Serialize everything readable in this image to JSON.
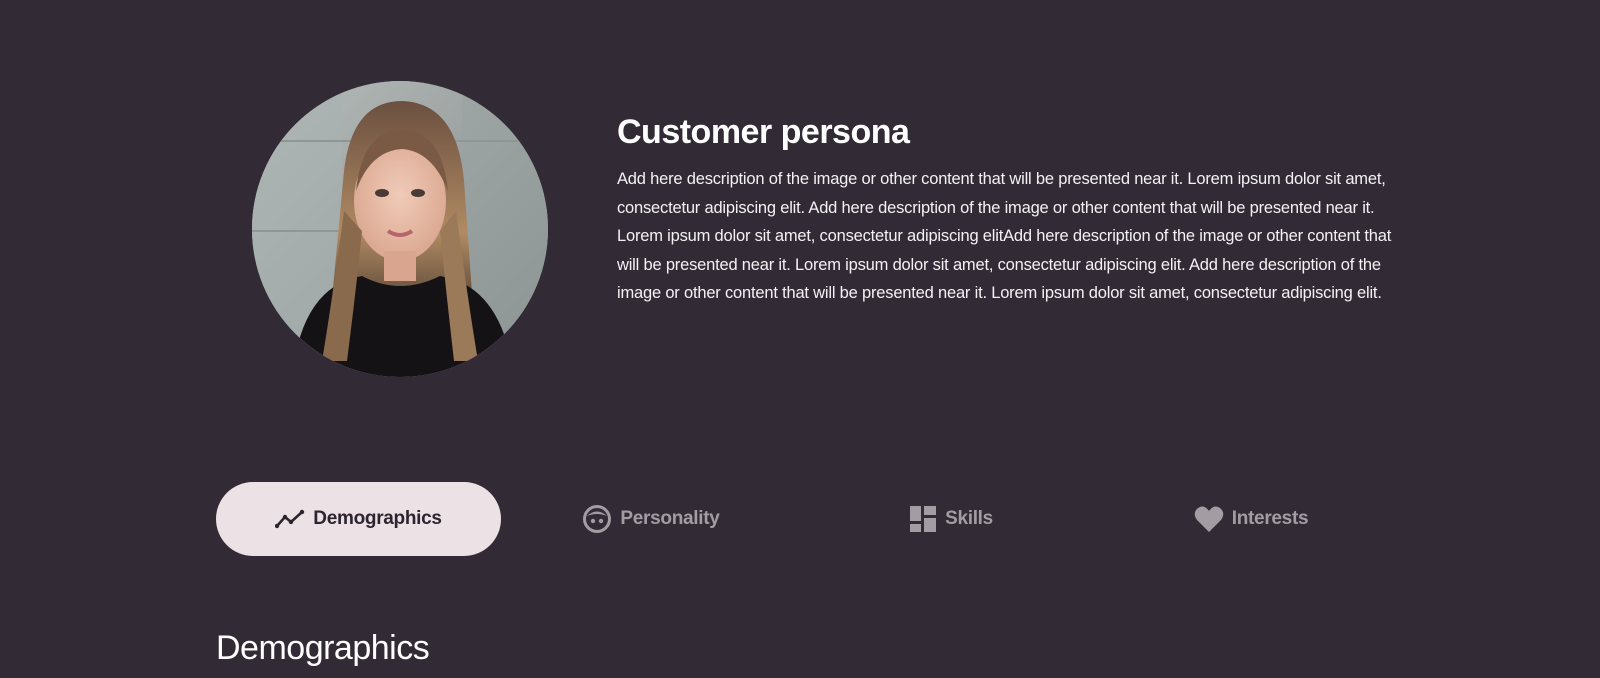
{
  "profile": {
    "title": "Customer persona",
    "description": "Add here description of the image or other content that will be presented near it. Lorem ipsum dolor sit amet, consectetur adipiscing elit. Add here description of the image or other content that will be presented near it. Lorem ipsum dolor sit amet, consectetur adipiscing elitAdd here description of the image or other content that will be presented near it. Lorem ipsum dolor sit amet, consectetur adipiscing elit. Add here description of the image or other content that will be presented near it. Lorem ipsum dolor sit amet, consectetur adipiscing elit."
  },
  "tabs": [
    {
      "label": "Demographics",
      "icon": "trend-line-icon",
      "active": true
    },
    {
      "label": "Personality",
      "icon": "face-icon",
      "active": false
    },
    {
      "label": "Skills",
      "icon": "dashboard-grid-icon",
      "active": false
    },
    {
      "label": "Interests",
      "icon": "heart-icon",
      "active": false
    }
  ],
  "section": {
    "heading": "Demographics"
  },
  "colors": {
    "background": "#322b35",
    "active_tab_bg": "#ece2e6",
    "active_tab_text": "#2c252e",
    "inactive_tab_text": "#a39ca3"
  }
}
